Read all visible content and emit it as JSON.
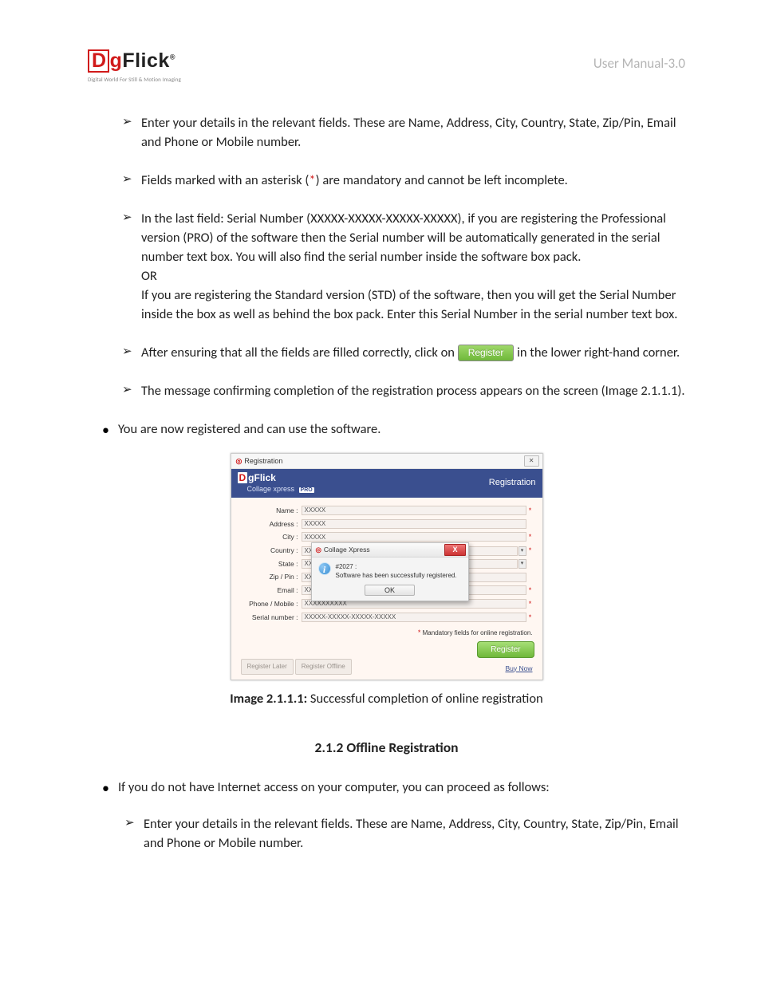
{
  "header": {
    "logo_text_d": "D",
    "logo_text_g": "g",
    "logo_text_flick": "Flick",
    "logo_reg": "®",
    "logo_tagline": "Digital World For Still & Motion Imaging",
    "doc_label": "User Manual-3.0"
  },
  "bullets_top": [
    {
      "pre": "Enter your details in the relevant fields. These are Name, Address, City, Country, State, Zip/Pin, Email and Phone or Mobile number."
    },
    {
      "pre": "Fields marked with an asterisk (",
      "ast": "*",
      "post": ") are mandatory and cannot be left incomplete."
    },
    {
      "pre": "In the last field: Serial Number (XXXXX-XXXXX-XXXXX-XXXXX), if you are registering the Professional version (PRO) of the software then the Serial number will be automatically generated in the serial number text box. You will also find the serial number inside the software box pack.",
      "or": "OR",
      "post2": "If you are registering the Standard version (STD) of the software, then you will get the Serial Number inside the box as well as behind the box pack. Enter this Serial Number in the serial number text box."
    },
    {
      "pre": "After ensuring that all the fields are filled correctly, click on ",
      "btn": "Register",
      "post": " in the lower right-hand corner."
    },
    {
      "pre": "The message confirming completion of the registration process appears on the screen (Image 2.1.1.1)."
    }
  ],
  "done_bullet": "You are now registered and can use the software.",
  "figure": {
    "window_title": "Registration",
    "close_glyph": "✕",
    "brand_collage": "Collage xpress",
    "pro_badge": "PRO",
    "header_right": "Registration",
    "fields": [
      {
        "label": "Name :",
        "value": "XXXXX",
        "ast": true,
        "dd": false
      },
      {
        "label": "Address :",
        "value": "XXXXX",
        "ast": false,
        "dd": false
      },
      {
        "label": "City :",
        "value": "XXXXX",
        "ast": true,
        "dd": false
      },
      {
        "label": "Country :",
        "value": "XXXXX",
        "ast": true,
        "dd": true
      },
      {
        "label": "State :",
        "value": "XXXXX",
        "ast": false,
        "dd": true
      },
      {
        "label": "Zip / Pin :",
        "value": "XXXXX",
        "ast": false,
        "dd": false
      },
      {
        "label": "Email :",
        "value": "XXXXX",
        "ast": true,
        "dd": false
      },
      {
        "label": "Phone / Mobile :",
        "value": "XXXXXXXXXX",
        "ast": true,
        "dd": false
      },
      {
        "label": "Serial number :",
        "value": "XXXXX-XXXXX-XXXXX-XXXXX",
        "ast": true,
        "dd": false
      }
    ],
    "mandatory_note_ast": "*",
    "mandatory_note": " Mandatory fields for online registration.",
    "btn_register_later": "Register Later",
    "btn_register_offline": "Register Offline",
    "btn_register": "Register",
    "buy_now": "Buy Now",
    "popup": {
      "title": "Collage Xpress",
      "close": "X",
      "code": "#2027 :",
      "msg": "Software has been successfully registered.",
      "ok": "OK"
    }
  },
  "caption_bold": "Image 2.1.1.1:",
  "caption_rest": " Successful completion of online registration",
  "section_heading": "2.1.2 Offline Registration",
  "offline_intro": "If you do not have Internet access on your computer, you can proceed as follows:",
  "offline_arrow": "Enter your details in the relevant fields. These are Name, Address, City, Country, State, Zip/Pin, Email and Phone or Mobile number."
}
